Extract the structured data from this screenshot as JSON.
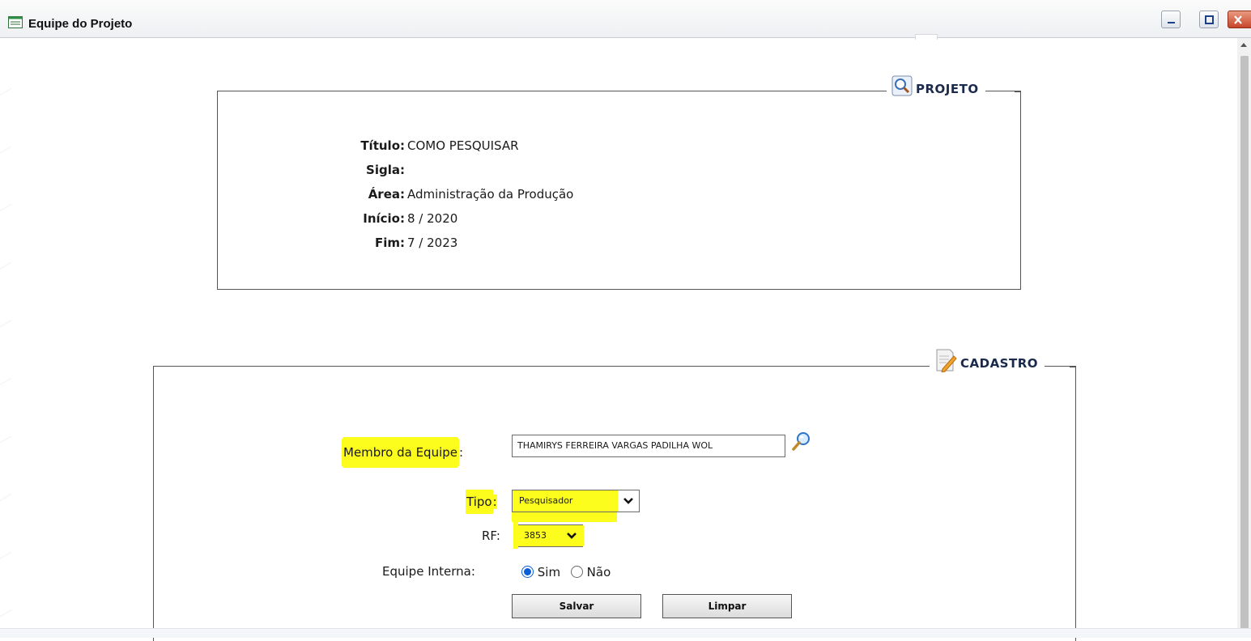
{
  "window": {
    "title": "Equipe do Projeto"
  },
  "projeto": {
    "legend": "PROJETO",
    "fields": [
      {
        "label": "Título:",
        "value": "COMO PESQUISAR"
      },
      {
        "label": "Sigla:",
        "value": ""
      },
      {
        "label": "Área:",
        "value": "Administração da Produção"
      },
      {
        "label": "Início:",
        "value": "8 / 2020"
      },
      {
        "label": "Fim:",
        "value": "7 / 2023"
      }
    ]
  },
  "cadastro": {
    "legend": "CADASTRO",
    "membro_label": "Membro da Equipe",
    "membro_colon": ":",
    "membro_value": "THAMIRYS FERREIRA VARGAS PADILHA WOL",
    "tipo_label": "Tipo",
    "tipo_colon": ":",
    "tipo_value": "Pesquisador",
    "rf_label": "RF:",
    "rf_value": "3853",
    "equipe_interna_label": "Equipe Interna:",
    "radio_sim": "Sim",
    "radio_nao": "Não",
    "radio_selected": "Sim",
    "salvar_label": "Salvar",
    "limpar_label": "Limpar"
  },
  "highlight_color": "#fcfc1d",
  "accent_color": "#0b5fd6"
}
